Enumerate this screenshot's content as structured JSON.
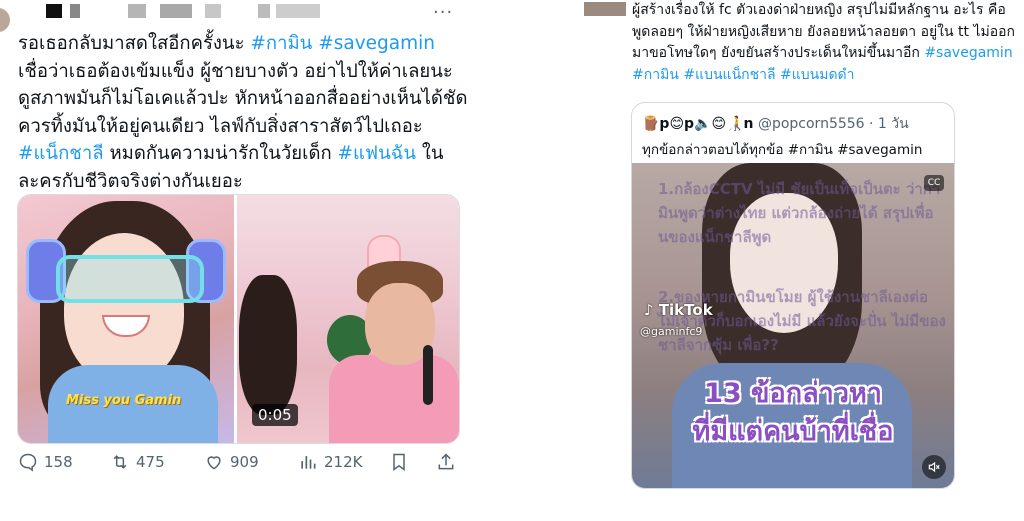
{
  "left_tweet": {
    "more_icon": "···",
    "text": {
      "p1": "รอเธอกลับมาสดใสอีกครั้งนะ ",
      "tag1": "#กามิน",
      "tag2": "#savegamin",
      "p2": "เชื่อว่าเธอต้องเข้มแข็ง ผู้ชายบางตัว อย่าไปให้ค่าเลยนะ ดูสภาพมันก็ไม่โอเคแล้วปะ หักหน้าออกสื่ออย่างเห็นได้ชัด ควรทิ้งมันให้อยู่คนเดียว ไลฟ์กับสิ่งสาราสัตว์ไปเถอะ ",
      "tag3": "#แน็กชาลี",
      "p3": " หมดกันความน่ารักในวัยเด็ก ",
      "tag4": "#แฟนฉัน",
      "p4": " ในละครกับชีวิตจริงต่างกันเยอะ"
    },
    "media": {
      "caption": "Miss you Gamin",
      "video_duration": "0:05"
    },
    "actions": {
      "replies": "158",
      "retweets": "475",
      "likes": "909",
      "views": "212K"
    }
  },
  "right_tweet": {
    "text": {
      "p1": "ผู้สร้างเรื่องให้ fc ตัวเองด่าฝ่ายหญิง สรุปไม่มีหลักฐาน อะไร คือ พูดลอยๆ ให้ฝ่ายหญิงเสียหาย ยังลอยหน้าลอยตา อยู่ใน tt ไม่ออกมาขอโทษใดๆ ยังขยันสร้างประเด็นใหม่ขึ้นมาอีก ",
      "tag1": "#savegamin",
      "tag2": "#กามิน",
      "tag3": "#แบนแน็กชาลี",
      "tag4": "#แบนมดดำ"
    },
    "quote": {
      "name": "🪵p😊p🔈😊🧑‍🦯n",
      "handle": "@popcorn5556",
      "time": "· 1 วัน",
      "text": "ทุกข้อกล่าวตอบได้ทุกข้อ #กามิน #savegamin",
      "video": {
        "overlay_top": "1.กล้องCCTV ไม่มี ชัยเป็นเท็จเป็นตะ ว่ากามินพูดว่าต่างไทย แต่วกล้องถ่ายได้ สรุปเพื่อนของแน็กชาลีพูด",
        "overlay_mid": "2.ของหายกามินขโมย ผู้ใช้งานชาลีเองต่อ ไม่เจ้าตัวก็บอกเองไม่มี แล้วยังจะปั่น ไม่มีของชาลีจากซุ้ม เพื่อ??",
        "tiktok_label": "TikTok",
        "tiktok_handle": "@gaminfc9",
        "headline1": "13 ข้อกล่าวหา",
        "headline2": "ที่มีแต่คนบ้าที่เชื่อ",
        "cc_label": "CC"
      }
    }
  },
  "colors": {
    "hashtag": "#1d9bf0",
    "secondary_text": "#536471",
    "headline_purple": "#8a4fc2"
  }
}
